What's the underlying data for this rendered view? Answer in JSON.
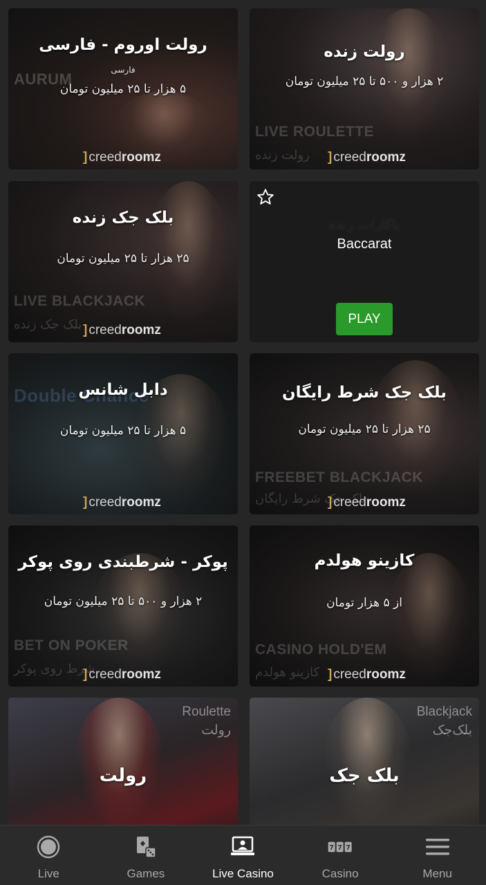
{
  "brand": {
    "name_light": "creed",
    "name_bold": "roomz"
  },
  "cards": [
    {
      "title": "رولت اوروم - فارسی",
      "subtitle_small": "فارسی",
      "subtitle": "۵ هزار تا ۲۵ میلیون تومان",
      "bg_text": "AURUM"
    },
    {
      "title": "رولت زنده",
      "subtitle": "۲ هزار و ۵۰۰ تا ۲۵ میلیون تومان",
      "watermark": "LIVE ROULETTE",
      "watermark_fa": "رولت زنده"
    },
    {
      "title": "بلک جک زنده",
      "subtitle": "۲۵ هزار تا ۲۵ میلیون تومان",
      "watermark": "LIVE BLACKJACK",
      "watermark_fa": "بلک جک زنده"
    },
    {
      "title": "Baccarat",
      "blurred": "باکارات زنده",
      "play_label": "PLAY",
      "favorite_icon": "star-outline-icon"
    },
    {
      "title": "دابل شانس",
      "subtitle": "۵ هزار تا ۲۵ میلیون تومان",
      "bg_text": "Double Chance"
    },
    {
      "title": "بلک جک شرط رایگان",
      "subtitle": "۲۵ هزار تا ۲۵ میلیون تومان",
      "watermark": "FREEBET BLACKJACK",
      "watermark_fa": "بلک جک شرط رایگان"
    },
    {
      "title": "پوکر - شرطبندی روی پوکر",
      "subtitle": "۲ هزار و ۵۰۰ تا ۲۵ میلیون تومان",
      "watermark": "BET ON POKER",
      "watermark_fa": "شرط روی پوکر"
    },
    {
      "title": "کازینو هولدم",
      "subtitle": "از ۵ هزار تومان",
      "watermark": "CASINO HOLD'EM",
      "watermark_fa": "کازینو هولدم"
    },
    {
      "title": "رولت",
      "corner_en": "Roulette",
      "corner_fa": "رولت"
    },
    {
      "title": "بلک جک",
      "corner_en": "Blackjack",
      "corner_fa": "بلک‌جک"
    }
  ],
  "nav": {
    "active_color": "#ffffff",
    "inactive_color": "#a9a9a9",
    "items": [
      {
        "label": "Live",
        "icon": "live-circle-icon"
      },
      {
        "label": "Games",
        "icon": "cards-dice-icon"
      },
      {
        "label": "Live Casino",
        "icon": "dealer-icon",
        "active": true
      },
      {
        "label": "Casino",
        "icon": "slot-777-icon"
      },
      {
        "label": "Menu",
        "icon": "hamburger-icon"
      }
    ]
  }
}
